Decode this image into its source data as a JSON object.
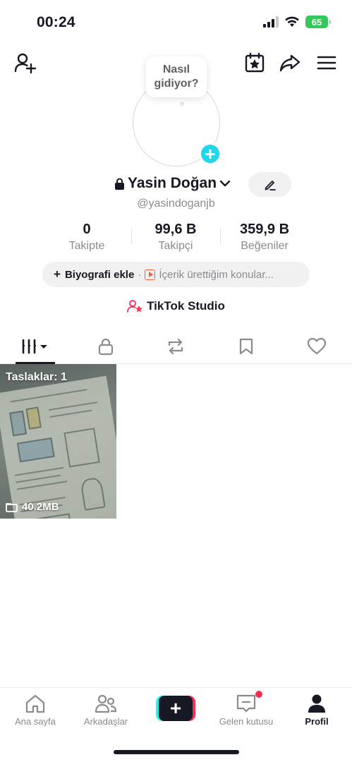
{
  "status_bar": {
    "time": "00:24",
    "battery": "65"
  },
  "profile": {
    "bubble_line1": "Nasıl",
    "bubble_line2": "gidiyor?",
    "name": "Yasin Doğan",
    "handle": "@yasindoganjb",
    "stats": [
      {
        "value": "0",
        "label": "Takipte"
      },
      {
        "value": "99,6 B",
        "label": "Takipçi"
      },
      {
        "value": "359,9 B",
        "label": "Beğeniler"
      }
    ],
    "bio_add": "Biyografi ekle",
    "bio_separator": "·",
    "bio_topic": "İçerik ürettiğim konular..."
  },
  "studio": {
    "label": "TikTok Studio"
  },
  "tabs": [
    "videos-grid-icon",
    "lock-icon",
    "repost-icon",
    "bookmark-icon",
    "heart-icon"
  ],
  "draft": {
    "title": "Taslaklar: 1",
    "size": "40.2MB"
  },
  "bottom_nav": {
    "items": [
      {
        "label": "Ana sayfa",
        "icon": "home-icon"
      },
      {
        "label": "Arkadaşlar",
        "icon": "friends-icon"
      },
      {
        "label": "",
        "icon": "plus-icon"
      },
      {
        "label": "Gelen kutusu",
        "icon": "inbox-icon"
      },
      {
        "label": "Profil",
        "icon": "profile-icon"
      }
    ]
  },
  "colors": {
    "accent_pink": "#fe2c55",
    "accent_cyan": "#25f4ee",
    "avatar_plus": "#20d5ec",
    "battery_green": "#34c759",
    "text_primary": "#161823",
    "text_secondary": "#8a8b91"
  }
}
